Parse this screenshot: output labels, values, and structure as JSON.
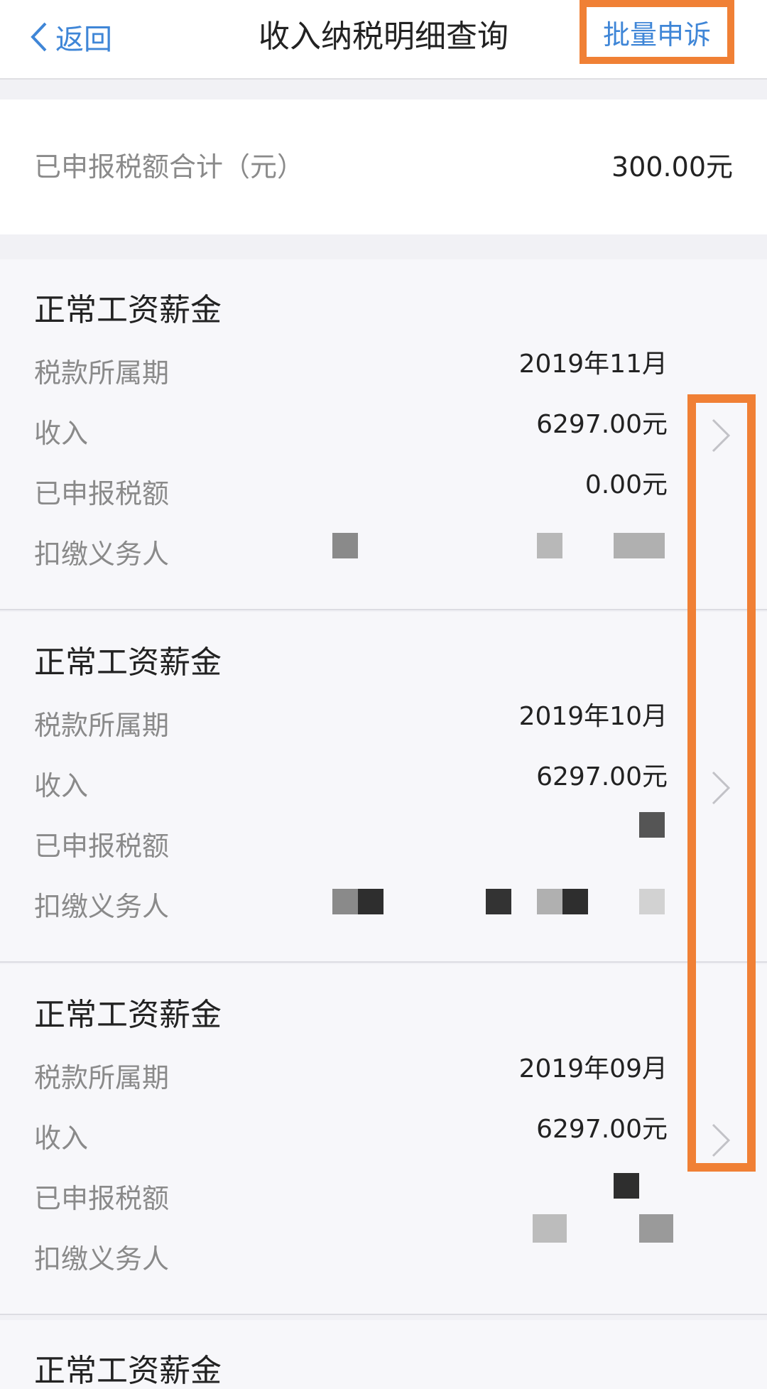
{
  "nav": {
    "back_label": "返回",
    "title": "收入纳税明细查询",
    "appeal_label": "批量申诉",
    "link_color": "#3f86d7",
    "highlight_color": "#f08035"
  },
  "summary": {
    "label": "已申报税额合计（元）",
    "value": "300.00元"
  },
  "row_labels": {
    "period": "税款所属期",
    "income": "收入",
    "tax": "已申报税额",
    "withholder": "扣缴义务人"
  },
  "records": [
    {
      "title": "正常工资薪金",
      "period": "2019年11月",
      "income": "6297.00元",
      "tax": "0.00元"
    },
    {
      "title": "正常工资薪金",
      "period": "2019年10月",
      "income": "6297.00元",
      "tax": ""
    },
    {
      "title": "正常工资薪金",
      "period": "2019年09月",
      "income": "6297.00元",
      "tax": ""
    },
    {
      "title": "正常工资薪金"
    }
  ]
}
